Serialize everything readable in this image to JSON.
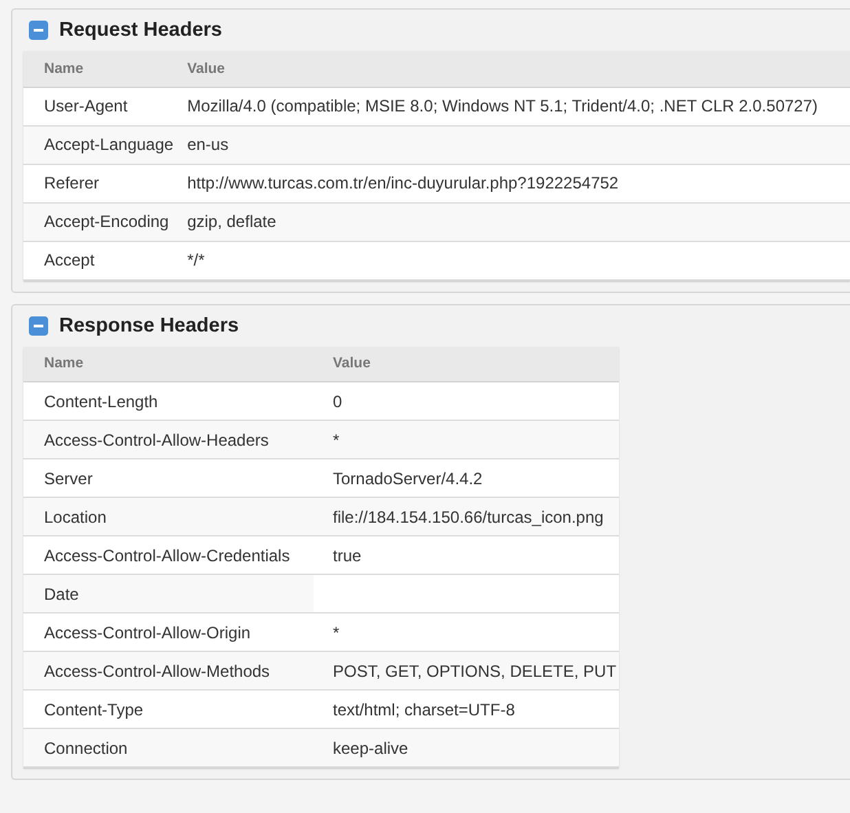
{
  "sections": [
    {
      "title": "Request Headers",
      "expanded": true,
      "columns": [
        "Name",
        "Value"
      ],
      "rows": [
        [
          "User-Agent",
          "Mozilla/4.0 (compatible; MSIE 8.0; Windows NT 5.1; Trident/4.0; .NET CLR 2.0.50727)"
        ],
        [
          "Accept-Language",
          "en-us"
        ],
        [
          "Referer",
          "http://www.turcas.com.tr/en/inc-duyurular.php?1922254752"
        ],
        [
          "Accept-Encoding",
          "gzip, deflate"
        ],
        [
          "Accept",
          "*/*"
        ]
      ]
    },
    {
      "title": "Response Headers",
      "expanded": true,
      "columns": [
        "Name",
        "Value"
      ],
      "rows": [
        [
          "Content-Length",
          "0"
        ],
        [
          "Access-Control-Allow-Headers",
          "*"
        ],
        [
          "Server",
          "TornadoServer/4.4.2"
        ],
        [
          "Location",
          "file://184.154.150.66/turcas_icon.png"
        ],
        [
          "Access-Control-Allow-Credentials",
          "true"
        ],
        [
          "Date",
          ""
        ],
        [
          "Access-Control-Allow-Origin",
          "*"
        ],
        [
          "Access-Control-Allow-Methods",
          "POST, GET, OPTIONS, DELETE, PUT"
        ],
        [
          "Content-Type",
          "text/html; charset=UTF-8"
        ],
        [
          "Connection",
          "keep-alive"
        ]
      ]
    }
  ]
}
